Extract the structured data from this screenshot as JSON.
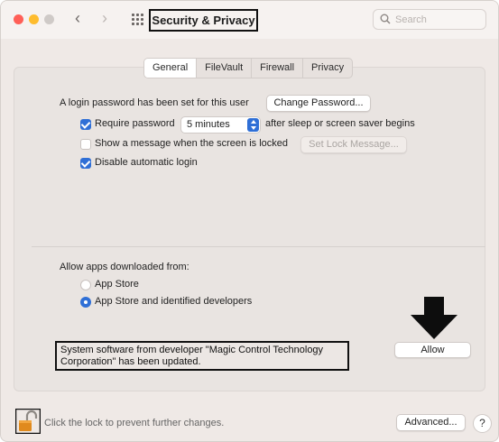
{
  "window": {
    "title": "Security & Privacy",
    "search_placeholder": "Search"
  },
  "tabs": [
    {
      "label": "General",
      "active": true
    },
    {
      "label": "FileVault",
      "active": false
    },
    {
      "label": "Firewall",
      "active": false
    },
    {
      "label": "Privacy",
      "active": false
    }
  ],
  "general": {
    "login_text": "A login password has been set for this user",
    "change_password_label": "Change Password...",
    "require_password_label": "Require password",
    "require_password_checked": true,
    "require_password_interval": "5 minutes",
    "after_sleep_text": "after sleep or screen saver begins",
    "show_message_label": "Show a message when the screen is locked",
    "show_message_checked": false,
    "set_lock_message_label": "Set Lock Message...",
    "disable_auto_login_label": "Disable automatic login",
    "disable_auto_login_checked": true
  },
  "downloads": {
    "heading": "Allow apps downloaded from:",
    "options": [
      {
        "label": "App Store",
        "selected": false
      },
      {
        "label": "App Store and identified developers",
        "selected": true
      }
    ]
  },
  "notice": {
    "text": "System software from developer \"Magic Control Technology Corporation\" has been updated.",
    "allow_label": "Allow"
  },
  "footer": {
    "lock_text": "Click the lock to prevent further changes.",
    "advanced_label": "Advanced...",
    "help_label": "?"
  },
  "colors": {
    "accent": "#2f6fd6",
    "window_bg": "#efe9e6",
    "lock": "#e08a1e"
  }
}
